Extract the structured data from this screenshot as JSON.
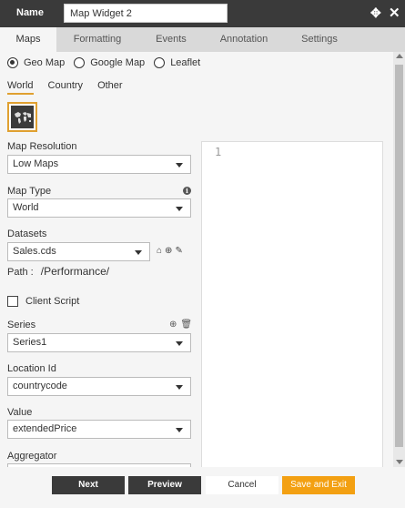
{
  "header": {
    "name_label": "Name",
    "widget_name": "Map Widget 2"
  },
  "tabs": [
    {
      "label": "Maps",
      "active": true
    },
    {
      "label": "Formatting",
      "active": false
    },
    {
      "label": "Events",
      "active": false
    },
    {
      "label": "Annotation",
      "active": false
    },
    {
      "label": "Settings",
      "active": false
    }
  ],
  "map_source": {
    "options": [
      "Geo Map",
      "Google Map",
      "Leaflet"
    ],
    "selected": "Geo Map"
  },
  "map_region_tabs": {
    "items": [
      "World",
      "Country",
      "Other"
    ],
    "selected": "World"
  },
  "form": {
    "map_resolution_label": "Map Resolution",
    "map_resolution_value": "Low Maps",
    "map_type_label": "Map Type",
    "map_type_value": "World",
    "datasets_label": "Datasets",
    "datasets_value": "Sales.cds",
    "path_label": "Path :",
    "path_value": "/Performance/",
    "client_script_label": "Client Script",
    "series_label": "Series",
    "series_value": "Series1",
    "location_id_label": "Location Id",
    "location_id_value": "countrycode",
    "value_label": "Value",
    "value_value": "extendedPrice",
    "aggregator_label": "Aggregator"
  },
  "editor": {
    "line_number": "1"
  },
  "footer": {
    "next_label": "Next",
    "preview_label": "Preview",
    "cancel_label": "Cancel",
    "save_exit_label": "Save and Exit"
  },
  "colors": {
    "accent": "#f3a012",
    "header_bg": "#3a3a3a"
  }
}
